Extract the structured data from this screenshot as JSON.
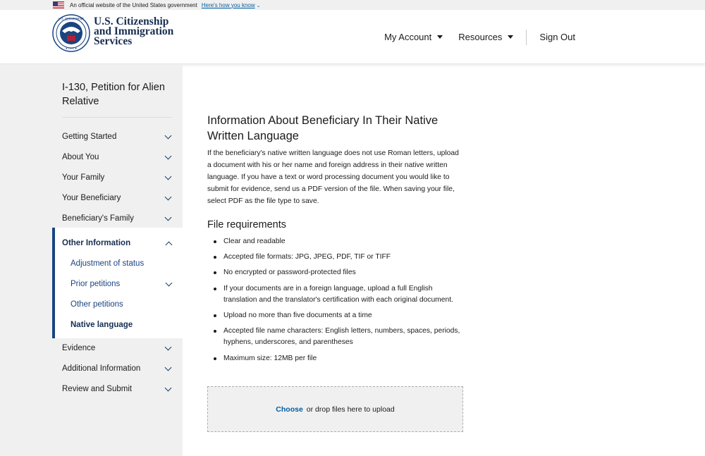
{
  "gov_banner": {
    "text": "An official website of the United States government",
    "link": "Here's how you know",
    "link_icon": "chevron-down-icon"
  },
  "header": {
    "logo_line1": "U.S. Citizenship",
    "logo_line2": "and Immigration",
    "logo_line3": "Services",
    "nav": {
      "my_account": "My Account",
      "resources": "Resources",
      "sign_out": "Sign Out"
    }
  },
  "sidebar": {
    "form_title": "I-130, Petition for Alien Relative",
    "items_top": [
      {
        "label": "Getting Started"
      },
      {
        "label": "About You"
      },
      {
        "label": "Your Family"
      },
      {
        "label": "Your Beneficiary"
      },
      {
        "label": "Beneficiary's Family"
      }
    ],
    "active_section": {
      "label": "Other Information",
      "sub_items": [
        {
          "label": "Adjustment of status"
        },
        {
          "label": "Prior petitions"
        },
        {
          "label": "Other petitions"
        },
        {
          "label": "Native language"
        }
      ]
    },
    "items_bottom": [
      {
        "label": "Evidence"
      },
      {
        "label": "Additional Information"
      },
      {
        "label": "Review and Submit"
      }
    ]
  },
  "main": {
    "heading": "Information About Beneficiary In Their Native Written Language",
    "intro": "If the beneficiary's native written language does not use Roman letters, upload a document with his or her name and foreign address in their native written language. If you have a text or word processing document you would like to submit for evidence, send us a PDF version of the file. When saving your file, select PDF as the file type to save.",
    "requirements_heading": "File requirements",
    "requirements": [
      "Clear and readable",
      "Accepted file formats: JPG, JPEG, PDF, TIF or TIFF",
      "No encrypted or password-protected files",
      "If your documents are in a foreign language, upload a full English translation and the translator's certification with each original document.",
      "Upload no more than five documents at a time",
      "Accepted file name characters: English letters, numbers, spaces, periods, hyphens, underscores, and parentheses",
      "Maximum size: 12MB per file"
    ],
    "dropzone": {
      "choose": "Choose",
      "text": "or drop files here to upload"
    }
  },
  "colors": {
    "primary": "#1a4480",
    "link": "#005ea2",
    "sidebar_bg": "#f0f0f0"
  }
}
